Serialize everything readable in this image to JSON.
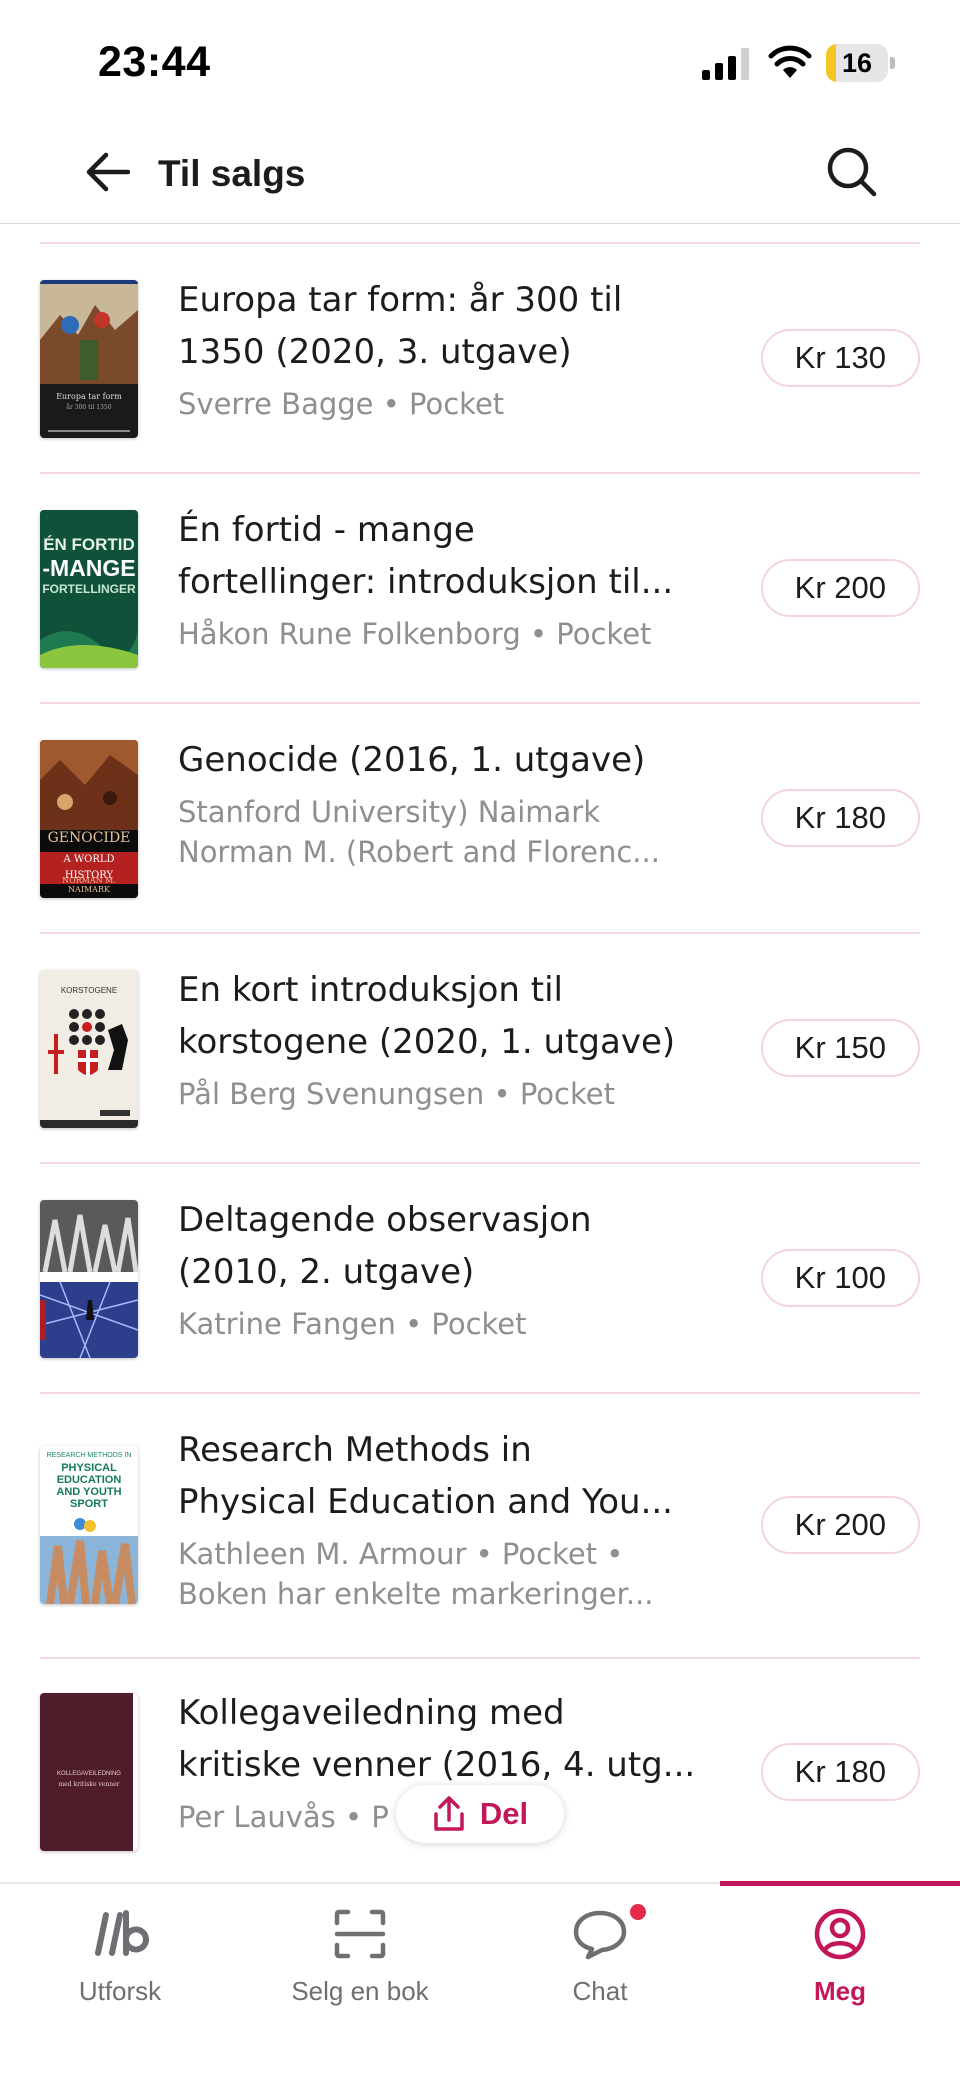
{
  "status_bar": {
    "time": "23:44",
    "battery": "16",
    "battery_fraction": 0.16
  },
  "header": {
    "title": "Til salgs"
  },
  "books": [
    {
      "title": "Europa tar form: år 300 til",
      "title2": "1350 (2020, 3. utgave)",
      "meta": "Sverre Bagge • Pocket",
      "meta2": "",
      "price": "Kr 130",
      "cover": "europa"
    },
    {
      "title": "Én fortid - mange",
      "title2": "fortellinger: introduksjon til...",
      "meta": "Håkon Rune Folkenborg • Pocket",
      "meta2": "",
      "price": "Kr 200",
      "cover": "fortid"
    },
    {
      "title": "Genocide (2016, 1. utgave)",
      "title2": "",
      "meta": "Stanford University) Naimark",
      "meta2": "Norman M. (Robert and Florenc...",
      "price": "Kr 180",
      "cover": "genocide"
    },
    {
      "title": "En kort introduksjon til",
      "title2": "korstogene (2020, 1. utgave)",
      "meta": "Pål Berg Svenungsen • Pocket",
      "meta2": "",
      "price": "Kr 150",
      "cover": "korstogene"
    },
    {
      "title": "Deltagende observasjon",
      "title2": "(2010, 2. utgave)",
      "meta": "Katrine Fangen • Pocket",
      "meta2": "",
      "price": "Kr 100",
      "cover": "deltagende"
    },
    {
      "title": "Research Methods in",
      "title2": "Physical Education and You...",
      "meta": "Kathleen M. Armour • Pocket •",
      "meta2": "Boken har enkelte markeringer...",
      "price": "Kr 200",
      "cover": "research"
    },
    {
      "title": "Kollegaveiledning med",
      "title2": "kritiske venner (2016, 4. utg...",
      "meta": "Per Lauvås • P",
      "meta2": "",
      "price": "Kr 180",
      "cover": "kollega"
    }
  ],
  "covers": {
    "europa": {
      "top_text": "Europa tar form",
      "sub_text": "år 300 til 1350"
    },
    "fortid": {
      "line1": "ÉN FORTID",
      "line2": "-MANGE",
      "line3": "FORTELLINGER"
    },
    "genocide": {
      "title": "GENOCIDE",
      "subtitle": "A WORLD HISTORY",
      "author": "NORMAN M. NAIMARK"
    },
    "korstogene": {
      "title": "KORSTOGENE"
    },
    "research": {
      "line1": "RESEARCH METHODS IN",
      "line2": "PHYSICAL",
      "line3": "EDUCATION",
      "line4": "AND YOUTH",
      "line5": "SPORT"
    },
    "kollega": {
      "title": "KOLLEGAVEILEDNING",
      "subtitle": "med kritiske venner"
    }
  },
  "share": {
    "label": "Del"
  },
  "tabs": [
    {
      "label": "Utforsk",
      "icon": "explore-icon",
      "active": false
    },
    {
      "label": "Selg en bok",
      "icon": "scan-icon",
      "active": false
    },
    {
      "label": "Chat",
      "icon": "chat-icon",
      "active": false,
      "badge": true
    },
    {
      "label": "Meg",
      "icon": "profile-icon",
      "active": true
    }
  ],
  "colors": {
    "accent": "#c2185b",
    "divider": "#f6d9e0",
    "muted_text": "#8e8e93",
    "badge": "#e5294b"
  }
}
